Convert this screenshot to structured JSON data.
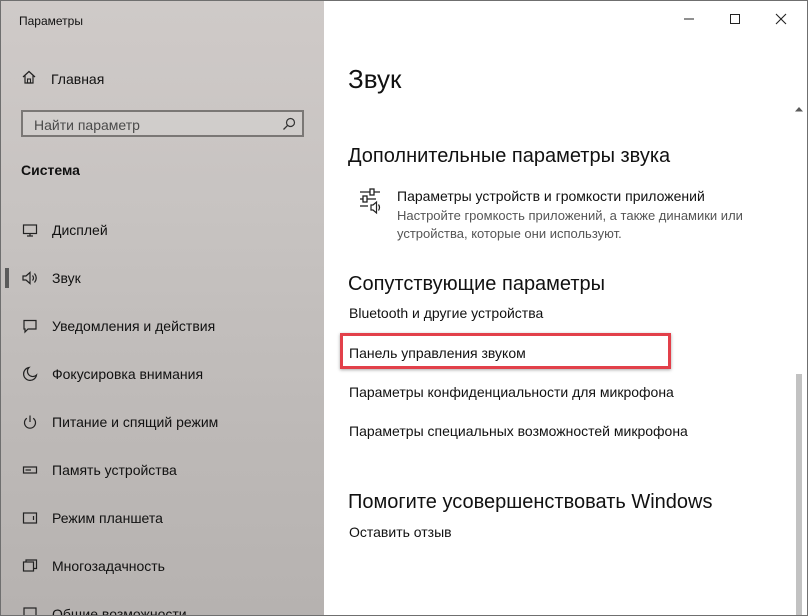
{
  "window": {
    "title": "Параметры"
  },
  "sidebar": {
    "home_label": "Главная",
    "search_placeholder": "Найти параметр",
    "section_label": "Система",
    "items": [
      {
        "label": "Дисплей",
        "icon": "monitor-icon"
      },
      {
        "label": "Звук",
        "icon": "speaker-icon",
        "selected": true
      },
      {
        "label": "Уведомления и действия",
        "icon": "notification-icon"
      },
      {
        "label": "Фокусировка внимания",
        "icon": "moon-icon"
      },
      {
        "label": "Питание и спящий режим",
        "icon": "power-icon"
      },
      {
        "label": "Память устройства",
        "icon": "storage-icon"
      },
      {
        "label": "Режим планшета",
        "icon": "tablet-icon"
      },
      {
        "label": "Многозадачность",
        "icon": "multitask-icon"
      },
      {
        "label": "Общие возможности",
        "icon": "shared-icon"
      }
    ]
  },
  "main": {
    "title": "Звук",
    "advanced": {
      "heading": "Дополнительные параметры звука",
      "item_title": "Параметры устройств и громкости приложений",
      "item_desc": "Настройте громкость приложений, а также динамики или устройства, которые они используют."
    },
    "related": {
      "heading": "Сопутствующие параметры",
      "links": [
        "Bluetooth и другие устройства",
        "Панель управления звуком",
        "Параметры конфиденциальности для микрофона",
        "Параметры специальных возможностей микрофона"
      ]
    },
    "improve": {
      "heading": "Помогите усовершенствовать Windows",
      "link": "Оставить отзыв"
    }
  },
  "colors": {
    "highlight": "#e2404a",
    "sidebar_bg": "#c7c3c1"
  }
}
